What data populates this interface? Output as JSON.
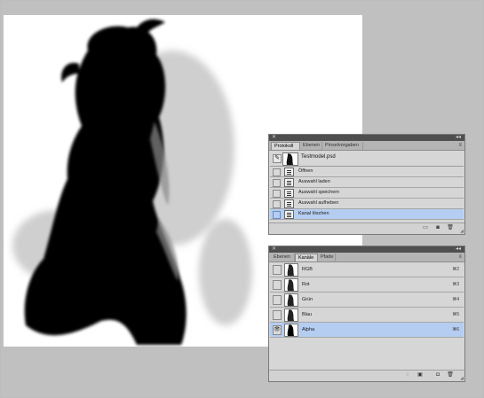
{
  "protokoll_panel": {
    "tabs": [
      {
        "label": "Protokoll",
        "active": true
      },
      {
        "label": "Ebenen",
        "active": false
      },
      {
        "label": "Pinselvorgaben",
        "active": false
      }
    ],
    "snapshot": {
      "label": "Testmodel.psd"
    },
    "history": [
      {
        "label": "Öffnen",
        "selected": false
      },
      {
        "label": "Auswahl laden",
        "selected": false
      },
      {
        "label": "Auswahl speichern",
        "selected": false
      },
      {
        "label": "Auswahl aufheben",
        "selected": false
      },
      {
        "label": "Kanal löschen",
        "selected": true
      }
    ],
    "footer_icons": [
      "new-document-from-state-icon",
      "camera-icon",
      "trash-icon"
    ]
  },
  "kanaele_panel": {
    "tabs": [
      {
        "label": "Ebenen",
        "active": false
      },
      {
        "label": "Kanäle",
        "active": true
      },
      {
        "label": "Pfade",
        "active": false
      }
    ],
    "channels": [
      {
        "label": "RGB",
        "shortcut": "⌘2",
        "selected": false,
        "visible": false
      },
      {
        "label": "Rot",
        "shortcut": "⌘3",
        "selected": false,
        "visible": false
      },
      {
        "label": "Grün",
        "shortcut": "⌘4",
        "selected": false,
        "visible": false
      },
      {
        "label": "Blau",
        "shortcut": "⌘5",
        "selected": false,
        "visible": false
      },
      {
        "label": "Alpha",
        "shortcut": "⌘6",
        "selected": true,
        "visible": true
      }
    ],
    "footer_icons": [
      "load-channel-selection-icon",
      "save-selection-icon",
      "new-channel-icon",
      "trash-icon"
    ]
  },
  "colors": {
    "workspace": "#bfc0bf",
    "panel": "#d6d6d6",
    "selection": "#b5cdf1"
  }
}
